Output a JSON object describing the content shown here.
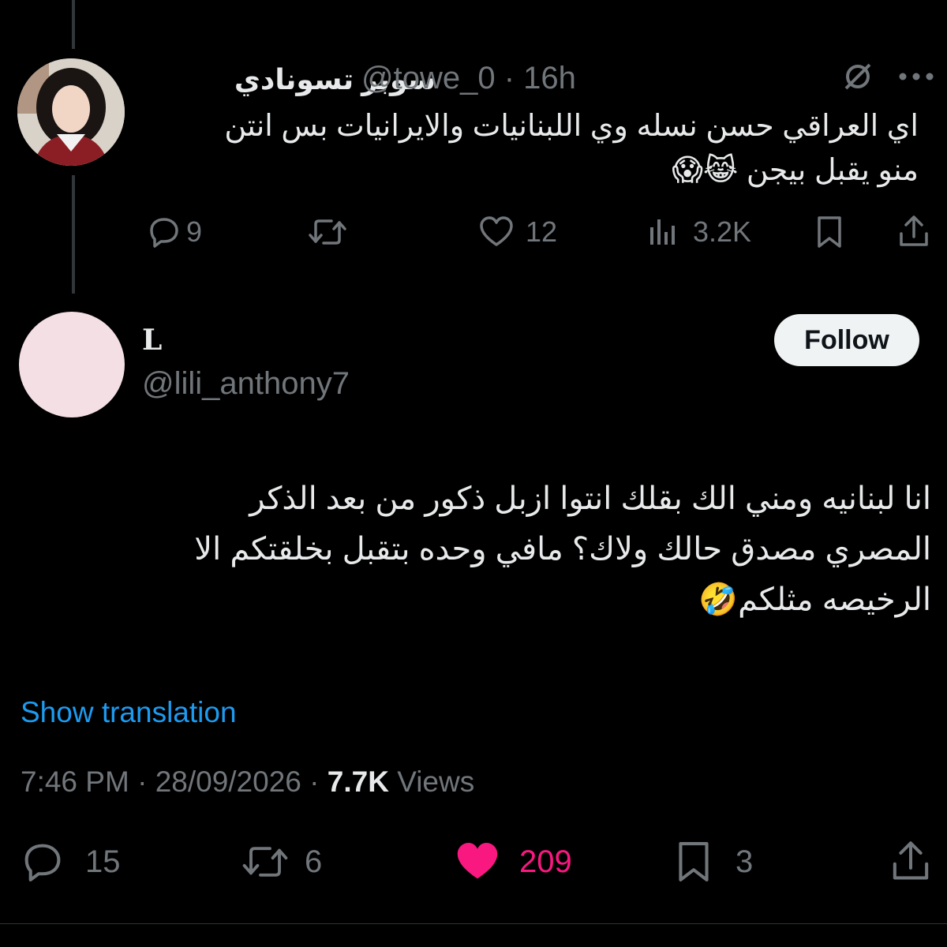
{
  "parent_tweet": {
    "display_name": "سوبر تسونادي",
    "handle": "@towe_0",
    "separator": "·",
    "time": "16h",
    "text_line1": "اي العراقي حسن نسله وي اللبنانيات والايرانيات بس انتن",
    "text_line2": "منو يقبل بيجن 😹😱",
    "stats": {
      "replies": "9",
      "retweets": "",
      "likes": "12",
      "views": "3.2K"
    },
    "icons": [
      "grok-icon",
      "more-icon",
      "reply-icon",
      "retweet-icon",
      "like-icon",
      "views-icon",
      "bookmark-icon",
      "share-icon"
    ]
  },
  "main_tweet": {
    "display_name": "L",
    "handle": "@lili_anthony7",
    "follow_label": "Follow",
    "text_line1": "انا لبنانيه ومني الك بقلك انتوا ازبل ذكور من بعد الذكر",
    "text_line2": "المصري مصدق حالك ولاك؟ مافي وحده بتقبل بخلقتكم الا",
    "text_line3": "الرخيصه مثلكم🤣",
    "show_translation": "Show translation",
    "time": "7:46 PM",
    "date": "28/09/2026",
    "views_count": "7.7K",
    "views_label": "Views",
    "stats": {
      "replies": "15",
      "retweets": "6",
      "likes": "209",
      "bookmarks": "3"
    },
    "colors": {
      "like_active": "#f91880",
      "link": "#1d9bf0",
      "muted": "#71767b"
    }
  }
}
